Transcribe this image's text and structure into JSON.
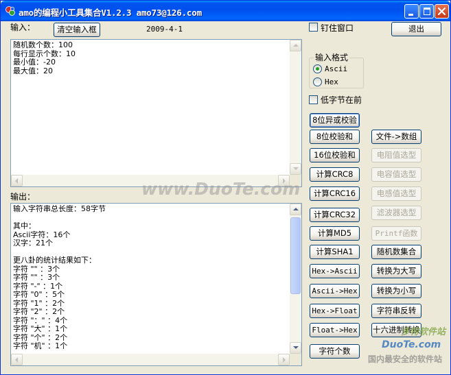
{
  "window": {
    "title": "amo的编程小工具集合V1.2.3 amo73@126.com"
  },
  "top": {
    "input_label": "输入：",
    "clear_button": "清空输入框",
    "date": "2009-4-1",
    "pin_window": "钉住窗口",
    "exit_button": "退出"
  },
  "input_box": {
    "lines": [
      "随机数个数：100",
      "每行显示个数：10",
      "最小值：-20",
      "最大值：20"
    ]
  },
  "output_label": "输出：",
  "output_box": {
    "lines": [
      "输入字符串总长度：58字节",
      "",
      "其中：",
      "Ascii字符：16个",
      "汉字：21个",
      "",
      "更八卦的统计结果如下：",
      "字符 \"\" ：3个",
      "字符 \"\" ：3个",
      "字符 \"-\" ：1个",
      "字符 \"0\" ：5个",
      "字符 \"1\" ：2个",
      "字符 \"2\" ：2个",
      "字符 \"：\" ：4个",
      "字符 \"大\" ：1个",
      "字符 \"个\" ：2个",
      "字符 \"机\" ：1个"
    ]
  },
  "input_format": {
    "title": "输入格式",
    "ascii": "Ascii",
    "hex": "Hex",
    "selected": "Ascii"
  },
  "low_byte_first": "低字节在前",
  "buttons_left": [
    "8位异或校验",
    "8位校验和",
    "16位校验和",
    "计算CRC8",
    "计算CRC16",
    "计算CRC32",
    "计算MD5",
    "计算SHA1",
    "Hex->Ascii",
    "Ascii->Hex",
    "Hex->Float",
    "Float->Hex",
    "字符个数"
  ],
  "buttons_right": [
    "文件->数组",
    "电阻值选型",
    "电容值选型",
    "电感值选型",
    "滤波器选型",
    "Printf函数",
    "随机数集合",
    "转换为大写",
    "转换为小写",
    "字符串反转",
    "十六进制转换"
  ],
  "watermarks": {
    "center": "www.DuoTe.com",
    "corner_top": "多特软件站",
    "corner_mid": "DuoTe.com",
    "corner_bottom": "国内最安全的软件站"
  }
}
